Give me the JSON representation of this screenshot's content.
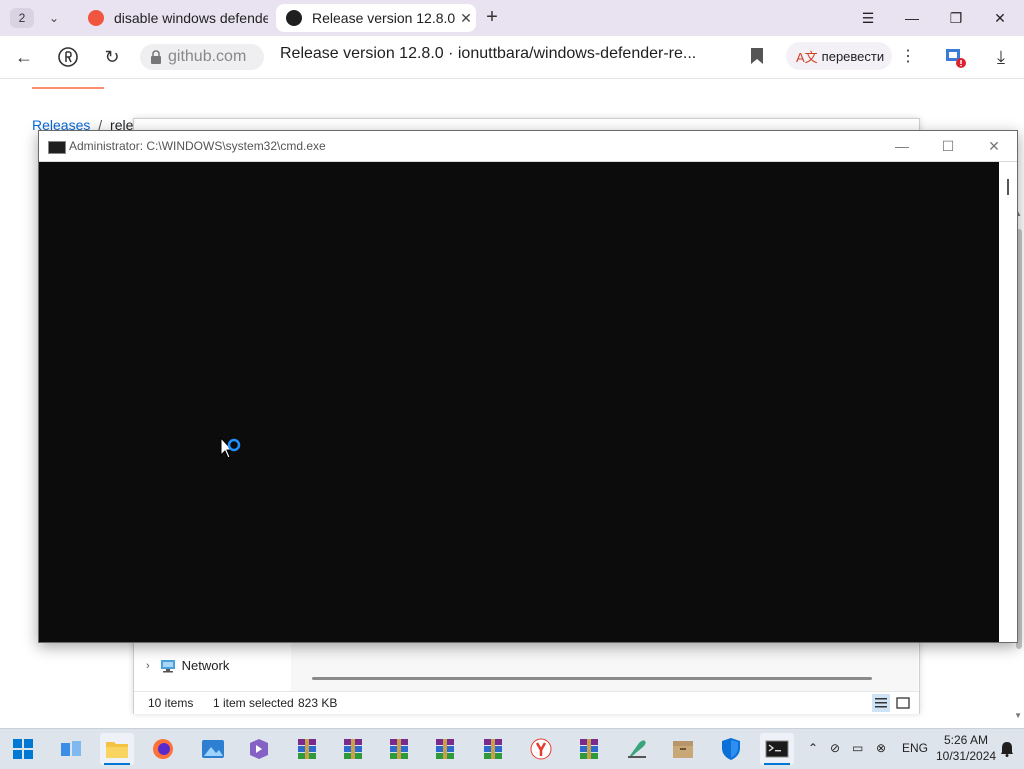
{
  "browser": {
    "tab_count": "2",
    "tabs": [
      {
        "title": "disable windows defender",
        "active": false
      },
      {
        "title": "Release version 12.8.0 ·",
        "active": true
      }
    ],
    "window_controls": {
      "menu": "☰",
      "minimize": "—",
      "restore": "❐",
      "close": "✕"
    },
    "domain": "github.com",
    "page_title": "Release version 12.8.0 · ionuttbara/windows-defender-re...",
    "translate_label": "перевести",
    "accent_color": "#0969da"
  },
  "page": {
    "breadcrumb": {
      "releases": "Releases",
      "separator": "/",
      "current": "releas"
    }
  },
  "explorer": {
    "nav_network": "Network",
    "status_items": "10 items",
    "status_selected": "1 item selected",
    "status_size": "823 KB"
  },
  "cmd": {
    "title": "Administrator: C:\\WINDOWS\\system32\\cmd.exe",
    "background": "#0c0c0c"
  },
  "taskbar": {
    "apps": [
      "windows-start-icon",
      "task-view-icon",
      "file-explorer-icon",
      "firefox-icon",
      "photos-icon",
      "visual-studio-installer-icon",
      "winrar-icon",
      "winrar-icon",
      "winrar-icon",
      "winrar-icon",
      "winrar-icon",
      "yandex-browser-icon",
      "winrar-icon",
      "feather-app-icon",
      "archive-box-icon",
      "windows-security-icon",
      "command-prompt-icon"
    ],
    "language": "ENG",
    "time": "5:26 AM",
    "date": "10/31/2024"
  }
}
